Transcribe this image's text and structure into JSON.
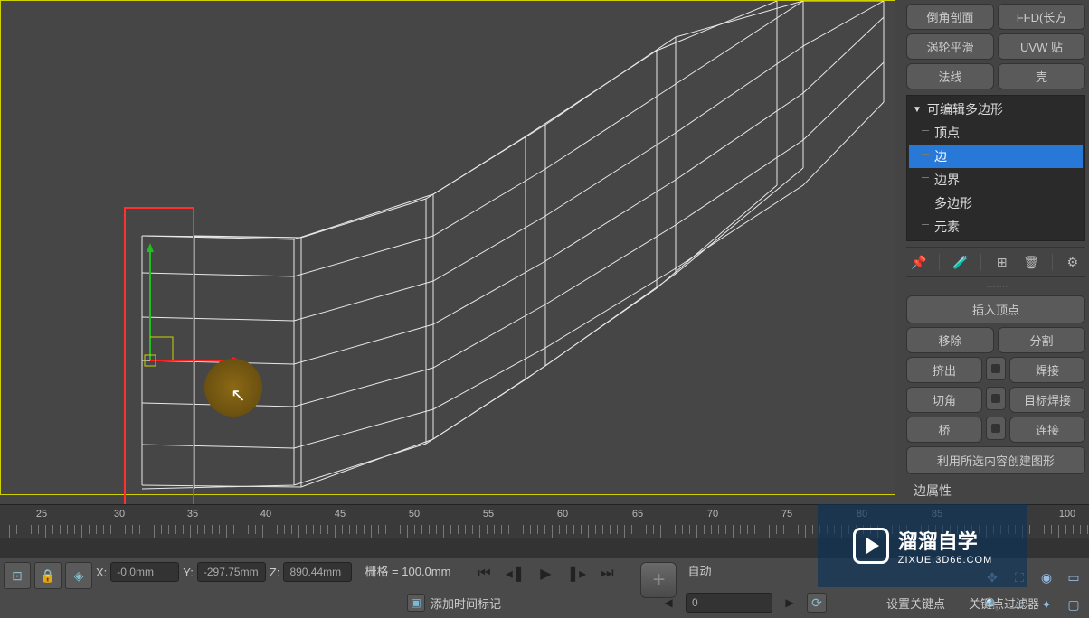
{
  "panel": {
    "row1": {
      "chamfer_profile": "倒角剖面",
      "ffd_box": "FFD(长方"
    },
    "row2": {
      "turbosmooth": "涡轮平滑",
      "uvw_map": "UVW 贴"
    },
    "row3": {
      "normal": "法线",
      "shell": "壳"
    }
  },
  "modifier": {
    "header": "可编辑多边形",
    "vertex": "顶点",
    "edge": "边",
    "border": "边界",
    "polygon": "多边形",
    "element": "元素"
  },
  "edit_edges": {
    "insert_vertex": "插入顶点",
    "remove": "移除",
    "split": "分割",
    "extrude": "挤出",
    "weld": "焊接",
    "chamfer": "切角",
    "target_weld": "目标焊接",
    "bridge": "桥",
    "connect": "连接",
    "create_shape": "利用所选内容创建图形",
    "edge_props": "边属性"
  },
  "coords": {
    "x_label": "X:",
    "x": "-0.0mm",
    "y_label": "Y:",
    "y": "-297.75mm",
    "z_label": "Z:",
    "z": "890.44mm"
  },
  "grid": "栅格 = 100.0mm",
  "add_time_tag": "添加时间标记",
  "frame_input": "0",
  "auto_key": "自动",
  "set_keys": "设置关键点",
  "key_filters": "关键点过滤器",
  "timeline_ticks": [
    "25",
    "30",
    "35",
    "40",
    "45",
    "50",
    "55",
    "60",
    "65",
    "70",
    "75",
    "80",
    "85",
    "100"
  ],
  "watermark": {
    "title": "溜溜自学",
    "sub": "ZIXUE.3D66.COM"
  }
}
